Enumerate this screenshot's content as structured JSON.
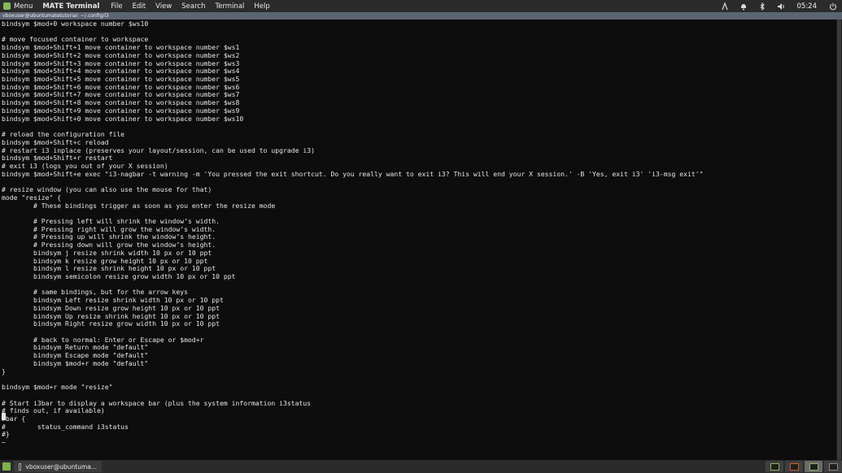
{
  "topbar": {
    "menu_label": "Menu",
    "app_name": "MATE Terminal",
    "menus": [
      "File",
      "Edit",
      "View",
      "Search",
      "Terminal",
      "Help"
    ],
    "clock": "05:24"
  },
  "window": {
    "title": "vboxuser@ubuntumatetutorial: ~/.config/i3"
  },
  "terminal": {
    "lines": [
      "bindsym $mod+0 workspace number $ws10",
      "",
      "# move focused container to workspace",
      "bindsym $mod+Shift+1 move container to workspace number $ws1",
      "bindsym $mod+Shift+2 move container to workspace number $ws2",
      "bindsym $mod+Shift+3 move container to workspace number $ws3",
      "bindsym $mod+Shift+4 move container to workspace number $ws4",
      "bindsym $mod+Shift+5 move container to workspace number $ws5",
      "bindsym $mod+Shift+6 move container to workspace number $ws6",
      "bindsym $mod+Shift+7 move container to workspace number $ws7",
      "bindsym $mod+Shift+8 move container to workspace number $ws8",
      "bindsym $mod+Shift+9 move container to workspace number $ws9",
      "bindsym $mod+Shift+0 move container to workspace number $ws10",
      "",
      "# reload the configuration file",
      "bindsym $mod+Shift+c reload",
      "# restart i3 inplace (preserves your layout/session, can be used to upgrade i3)",
      "bindsym $mod+Shift+r restart",
      "# exit i3 (logs you out of your X session)",
      "bindsym $mod+Shift+e exec \"i3-nagbar -t warning -m 'You pressed the exit shortcut. Do you really want to exit i3? This will end your X session.' -B 'Yes, exit i3' 'i3-msg exit'\"",
      "",
      "# resize window (you can also use the mouse for that)",
      "mode \"resize\" {",
      "        # These bindings trigger as soon as you enter the resize mode",
      "",
      "        # Pressing left will shrink the window’s width.",
      "        # Pressing right will grow the window’s width.",
      "        # Pressing up will shrink the window’s height.",
      "        # Pressing down will grow the window’s height.",
      "        bindsym j resize shrink width 10 px or 10 ppt",
      "        bindsym k resize grow height 10 px or 10 ppt",
      "        bindsym l resize shrink height 10 px or 10 ppt",
      "        bindsym semicolon resize grow width 10 px or 10 ppt",
      "",
      "        # same bindings, but for the arrow keys",
      "        bindsym Left resize shrink width 10 px or 10 ppt",
      "        bindsym Down resize grow height 10 px or 10 ppt",
      "        bindsym Up resize shrink height 10 px or 10 ppt",
      "        bindsym Right resize grow width 10 px or 10 ppt",
      "",
      "        # back to normal: Enter or Escape or $mod+r",
      "        bindsym Return mode \"default\"",
      "        bindsym Escape mode \"default\"",
      "        bindsym $mod+r mode \"default\"",
      "}",
      "",
      "bindsym $mod+r mode \"resize\"",
      "",
      "# Start i3bar to display a workspace bar (plus the system information i3status",
      "# finds out, if available)",
      "#bar {",
      "#        status_command i3status",
      "#}",
      "~"
    ]
  },
  "taskbar": {
    "task_label": "vboxuser@ubuntuma..."
  },
  "icons": {
    "tray": [
      "network-icon",
      "bell-icon",
      "bluetooth-icon",
      "volume-icon",
      "power-icon"
    ]
  }
}
